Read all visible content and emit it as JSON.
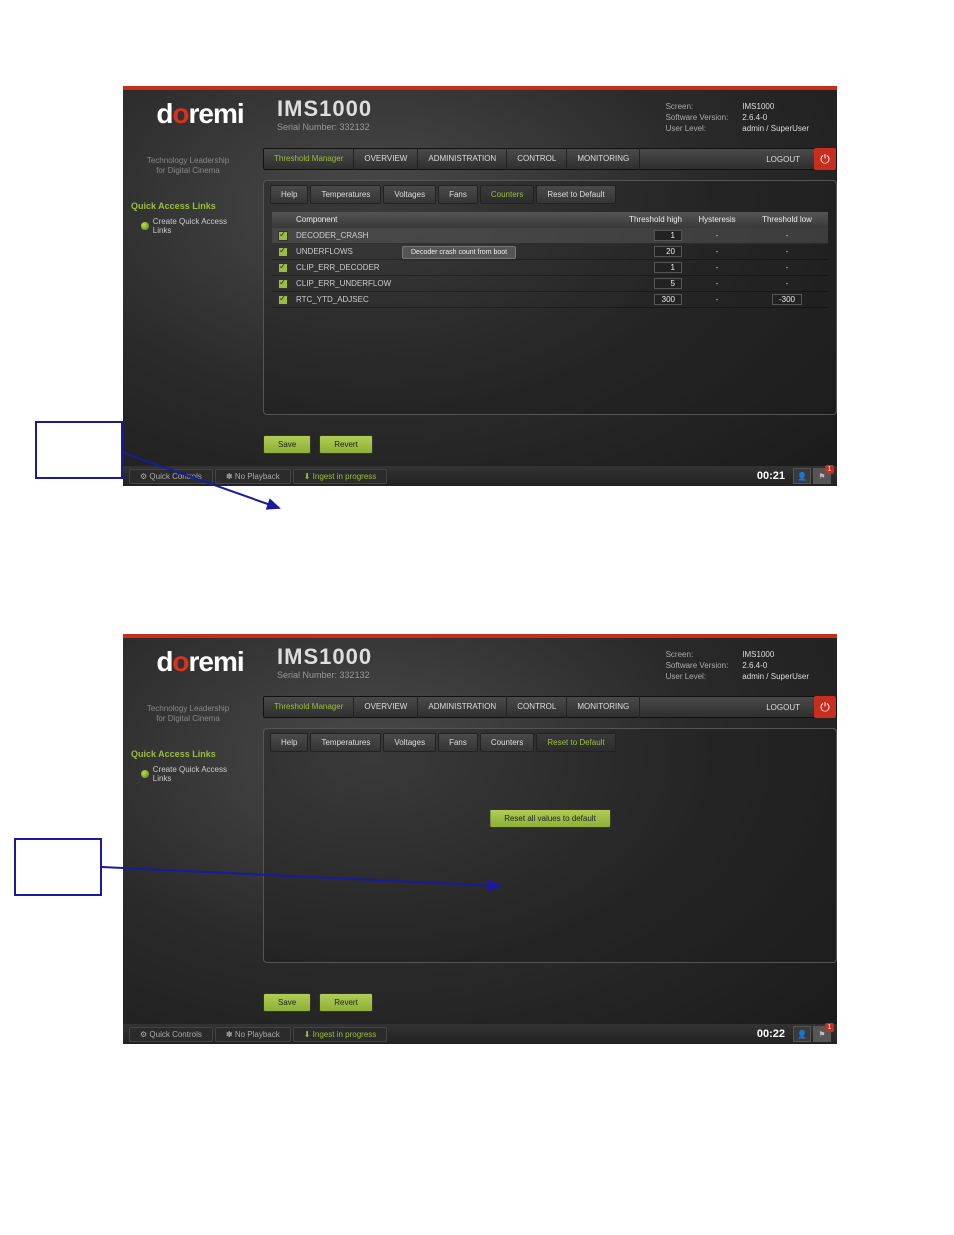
{
  "shot1": {
    "logo": {
      "pre": "d",
      "o1": "o",
      "mid": "remi"
    },
    "title": "IMS1000",
    "serial_label": "Serial Number:",
    "serial_value": "332132",
    "header_info": {
      "screen_label": "Screen:",
      "screen_value": "IMS1000",
      "sw_label": "Software Version:",
      "sw_value": "2.6.4-0",
      "user_label": "User Level:",
      "user_value": "admin / SuperUser"
    },
    "tagline1": "Technology Leadership",
    "tagline2": "for Digital Cinema",
    "qa_title": "Quick Access Links",
    "qa_create": "Create Quick Access Links",
    "breadcrumb": {
      "thresh": "Threshold Manager",
      "overview": "OVERVIEW",
      "admin": "ADMINISTRATION",
      "control": "CONTROL",
      "monitor": "MONITORING",
      "logout": "LOGOUT"
    },
    "tabs": {
      "help": "Help",
      "temps": "Temperatures",
      "volts": "Voltages",
      "fans": "Fans",
      "counters": "Counters",
      "reset": "Reset to Default"
    },
    "thead": {
      "component": "Component",
      "high": "Threshold high",
      "hyst": "Hysteresis",
      "low": "Threshold low"
    },
    "rows": [
      {
        "name": "DECODER_CRASH",
        "high": "1",
        "hyst": "-",
        "low": "-"
      },
      {
        "name": "UNDERFLOWS",
        "high": "20",
        "hyst": "-",
        "low": "-"
      },
      {
        "name": "CLIP_ERR_DECODER",
        "high": "1",
        "hyst": "-",
        "low": "-"
      },
      {
        "name": "CLIP_ERR_UNDERFLOW",
        "high": "5",
        "hyst": "-",
        "low": "-"
      },
      {
        "name": "RTC_YTD_ADJSEC",
        "high": "300",
        "hyst": "-",
        "low": "-300"
      }
    ],
    "tooltip": "Decoder crash count from boot",
    "buttons": {
      "save": "Save",
      "revert": "Revert"
    },
    "footer": {
      "quick": "Quick Controls",
      "noplay": "No Playback",
      "ingest": "Ingest in progress",
      "time": "00:21"
    }
  },
  "shot2": {
    "logo": {
      "pre": "d",
      "o1": "o",
      "mid": "remi"
    },
    "title": "IMS1000",
    "serial_label": "Serial Number:",
    "serial_value": "332132",
    "header_info": {
      "screen_label": "Screen:",
      "screen_value": "IMS1000",
      "sw_label": "Software Version:",
      "sw_value": "2.6.4-0",
      "user_label": "User Level:",
      "user_value": "admin / SuperUser"
    },
    "tagline1": "Technology Leadership",
    "tagline2": "for Digital Cinema",
    "qa_title": "Quick Access Links",
    "qa_create": "Create Quick Access Links",
    "breadcrumb": {
      "thresh": "Threshold Manager",
      "overview": "OVERVIEW",
      "admin": "ADMINISTRATION",
      "control": "CONTROL",
      "monitor": "MONITORING",
      "logout": "LOGOUT"
    },
    "tabs": {
      "help": "Help",
      "temps": "Temperatures",
      "volts": "Voltages",
      "fans": "Fans",
      "counters": "Counters",
      "reset": "Reset to Default"
    },
    "reset_button": "Reset all values to default",
    "buttons": {
      "save": "Save",
      "revert": "Revert"
    },
    "footer": {
      "quick": "Quick Controls",
      "noplay": "No Playback",
      "ingest": "Ingest in progress",
      "time": "00:22"
    }
  }
}
